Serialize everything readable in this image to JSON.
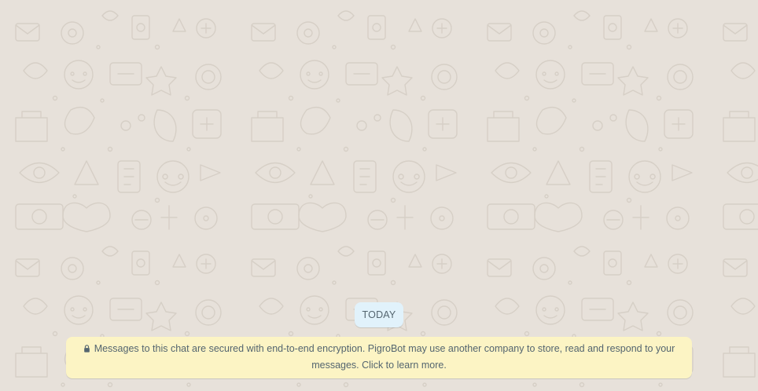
{
  "chat": {
    "date_chip": "TODAY",
    "encryption_notice": "Messages to this chat are secured with end-to-end encryption. PigroBot may use another company to store, read and respond to your messages. Click to learn more."
  },
  "icons": {
    "lock": "lock-icon",
    "background": "doodle-pattern"
  },
  "colors": {
    "background": "#e7e1da",
    "date_chip_bg": "#e1f2fb",
    "notice_bg": "#fcf4c4",
    "text": "#54656f"
  }
}
